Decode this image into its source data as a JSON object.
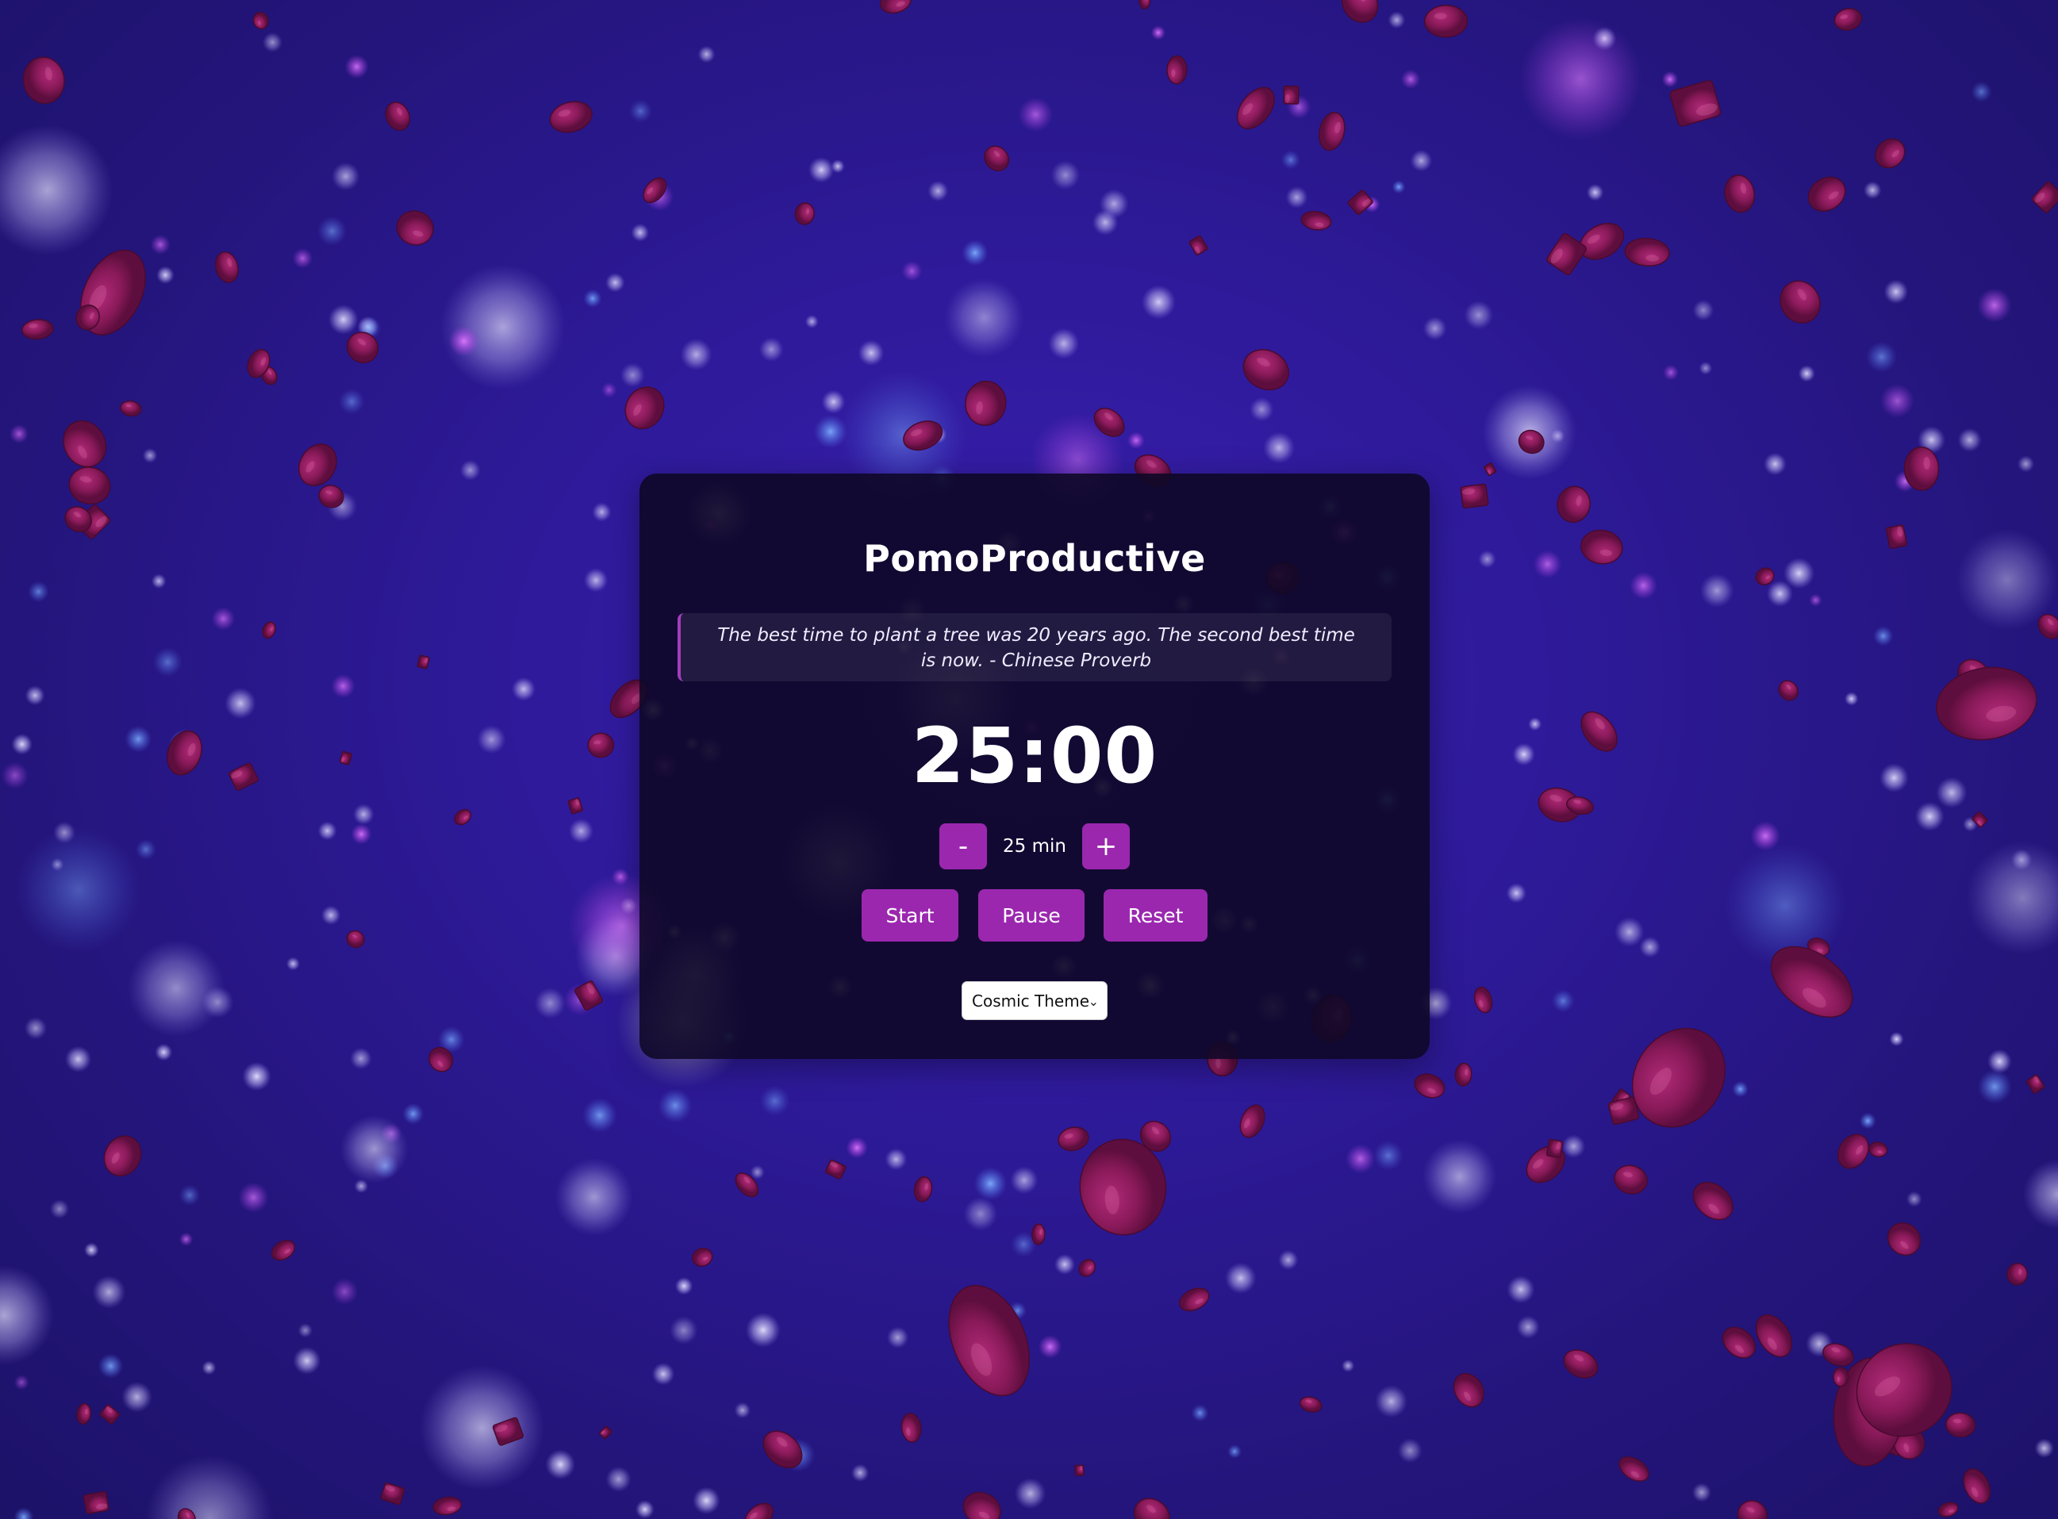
{
  "app": {
    "title": "PomoProductive"
  },
  "quote": {
    "text": "The best time to plant a tree was 20 years ago. The second best time is now. - Chinese Proverb"
  },
  "timer": {
    "display": "25:00"
  },
  "duration": {
    "decrement_label": "-",
    "value_label": "25 min",
    "increment_label": "+",
    "minutes": 25
  },
  "controls": {
    "start_label": "Start",
    "pause_label": "Pause",
    "reset_label": "Reset"
  },
  "theme": {
    "selected": "Cosmic Theme"
  },
  "colors": {
    "accent": "#9b27af",
    "background": "#2e1a9a",
    "panel": "#0e0826",
    "particle": "#8a1a5a"
  },
  "icons": {
    "select_chevron": "chevron-down-icon"
  }
}
